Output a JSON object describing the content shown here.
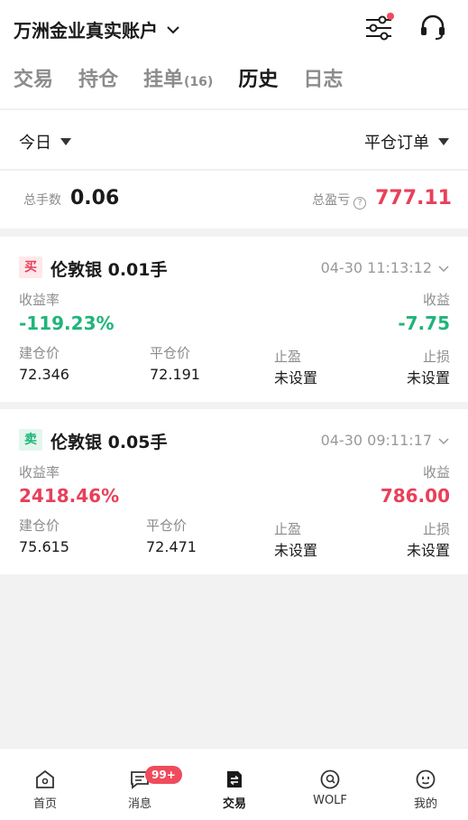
{
  "header": {
    "account_name": "万洲金业真实账户",
    "icons": [
      "chevron-down-icon",
      "filter-settings-icon",
      "customer-service-headset-icon"
    ]
  },
  "tabs": [
    {
      "label": "交易",
      "active": false
    },
    {
      "label": "持仓",
      "active": false
    },
    {
      "label": "挂单",
      "count": "(16)",
      "active": false
    },
    {
      "label": "历史",
      "active": true
    },
    {
      "label": "日志",
      "active": false
    }
  ],
  "filter": {
    "period": "今日",
    "order_type": "平仓订单"
  },
  "summary": {
    "total_lots_label": "总手数",
    "total_lots": "0.06",
    "total_pnl_label": "总盈亏",
    "total_pnl": "777.11"
  },
  "orders": [
    {
      "side": "买",
      "title": "伦敦银 0.01手",
      "time": "04-30 11:13:12",
      "rate_label": "收益率",
      "rate": "-119.23%",
      "profit_label": "收益",
      "profit": "-7.75",
      "open_label": "建仓价",
      "open_price": "72.346",
      "close_label": "平仓价",
      "close_price": "72.191",
      "tp_label": "止盈",
      "tp_value": "未设置",
      "sl_label": "止损",
      "sl_value": "未设置"
    },
    {
      "side": "卖",
      "title": "伦敦银 0.05手",
      "time": "04-30 09:11:17",
      "rate_label": "收益率",
      "rate": "2418.46%",
      "profit_label": "收益",
      "profit": "786.00",
      "open_label": "建仓价",
      "open_price": "75.615",
      "close_label": "平仓价",
      "close_price": "72.471",
      "tp_label": "止盈",
      "tp_value": "未设置",
      "sl_label": "止损",
      "sl_value": "未设置"
    }
  ],
  "tabbar": [
    {
      "label": "首页",
      "icon": "home-icon"
    },
    {
      "label": "消息",
      "icon": "message-icon",
      "badge": "99+"
    },
    {
      "label": "交易",
      "icon": "trade-icon",
      "active": true
    },
    {
      "label": "WOLF",
      "icon": "wolf-icon"
    },
    {
      "label": "我的",
      "icon": "profile-icon"
    }
  ],
  "colors": {
    "up_red": "#e8405a",
    "down_green": "#1fb57a",
    "muted": "#8c8c8c"
  }
}
